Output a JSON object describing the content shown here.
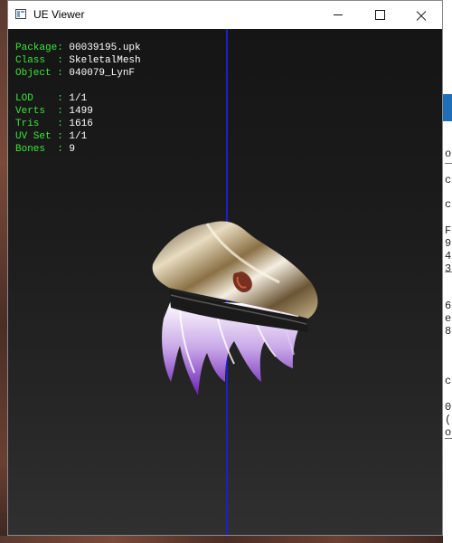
{
  "window": {
    "title": "UE Viewer"
  },
  "info": {
    "package": {
      "label": "Package: ",
      "value": "00039195.upk"
    },
    "class": {
      "label": "Class  : ",
      "value": "SkeletalMesh"
    },
    "object": {
      "label": "Object : ",
      "value": "040079_LynF"
    },
    "lod": {
      "label": "LOD    : ",
      "value": "1/1"
    },
    "verts": {
      "label": "Verts  : ",
      "value": "1499"
    },
    "tris": {
      "label": "Tris   : ",
      "value": "1616"
    },
    "uvset": {
      "label": "UV Set : ",
      "value": "1/1"
    },
    "bones": {
      "label": "Bones  : ",
      "value": "9"
    }
  },
  "background_window_chars": [
    "o",
    "c",
    "c",
    "F",
    "9",
    "4",
    "3",
    "6",
    "e",
    "8",
    "c",
    "0",
    "(",
    "o"
  ],
  "colors": {
    "label_green": "#39e639",
    "axis_blue": "#1a1fd0",
    "accent_blue": "#1e6fb8"
  }
}
